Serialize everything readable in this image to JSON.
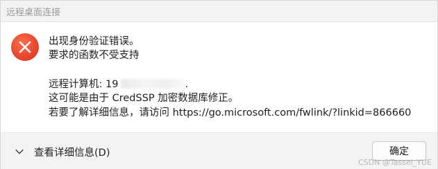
{
  "window": {
    "title": "远程桌面连接"
  },
  "icons": {
    "error": "error-x-icon",
    "chevron": "chevron-down-icon"
  },
  "colors": {
    "error_icon": "#e8482f"
  },
  "message": {
    "line1": "出现身份验证错误。",
    "line2": "要求的函数不受支持",
    "line3_prefix": "远程计算机: 19",
    "line3_suffix": ".",
    "line4": "这可能是由于 CredSSP 加密数据库修正。",
    "line5": "若要了解详细信息，请访问 https://go.microsoft.com/fwlink/?linkid=866660"
  },
  "footer": {
    "details_label": "查看详细信息(D)",
    "ok_label": "确定"
  },
  "watermark": "CSDN @Tassel_YUE"
}
